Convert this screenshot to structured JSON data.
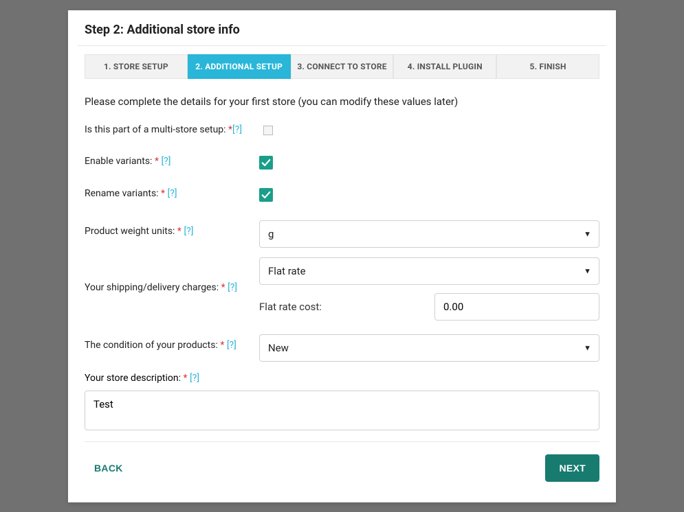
{
  "title": "Step 2: Additional store info",
  "steps": [
    {
      "label": "1. STORE SETUP"
    },
    {
      "label": "2. ADDITIONAL SETUP"
    },
    {
      "label": "3. CONNECT TO STORE"
    },
    {
      "label": "4. INSTALL PLUGIN"
    },
    {
      "label": "5. FINISH"
    }
  ],
  "active_step": 1,
  "intro": "Please complete the details for your first store (you can modify these values later)",
  "help_text": "[?]",
  "fields": {
    "multistore": {
      "label": "Is this part of a multi-store setup: ",
      "checked": false
    },
    "enable_variants": {
      "label": "Enable variants: ",
      "checked": true
    },
    "rename_variants": {
      "label": "Rename variants: ",
      "checked": true
    },
    "weight_units": {
      "label": "Product weight units: ",
      "value": "g"
    },
    "shipping": {
      "label": "Your shipping/delivery charges: ",
      "type_value": "Flat rate",
      "flat_label": "Flat rate cost:",
      "flat_value": "0.00"
    },
    "condition": {
      "label": "The condition of your products: ",
      "value": "New"
    },
    "description": {
      "label": "Your store description: ",
      "value": "Test"
    }
  },
  "footer": {
    "back": "BACK",
    "next": "NEXT"
  }
}
